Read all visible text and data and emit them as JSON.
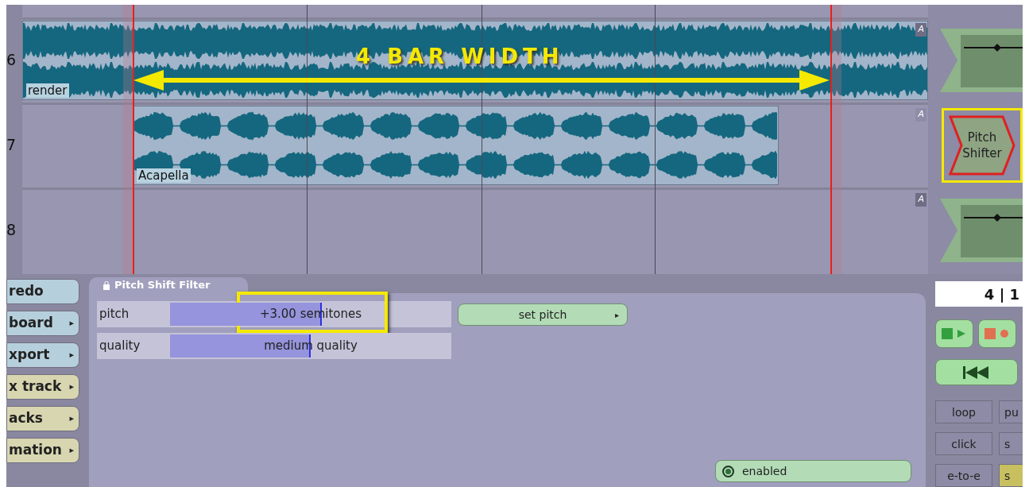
{
  "tracks": [
    {
      "number": "6",
      "badge": "A",
      "clip": {
        "name": "render",
        "kind": "full"
      },
      "plugin": {
        "kind": "automation"
      }
    },
    {
      "number": "7",
      "badge": "A",
      "clip": {
        "name": "Acapella",
        "kind": "vocal"
      },
      "plugin": {
        "kind": "effect",
        "label": "Pitch Shifter",
        "highlighted": true
      }
    },
    {
      "number": "8",
      "badge": "A",
      "plugin": {
        "kind": "automation"
      }
    }
  ],
  "annotation": {
    "text": "4 BAR WIDTH"
  },
  "menu": [
    {
      "label": "redo",
      "color": "#b6cfdc"
    },
    {
      "label": "board",
      "arrow": "▸",
      "color": "#b6cfdc"
    },
    {
      "label": "xport",
      "arrow": "▸",
      "color": "#b6cfdc"
    },
    {
      "label": "x track",
      "arrow": "▸",
      "color": "#d8d6b0"
    },
    {
      "label": "acks",
      "arrow": "▸",
      "color": "#d8d6b0"
    },
    {
      "label": "mation",
      "arrow": "▸",
      "color": "#d8d6b0"
    }
  ],
  "filter_panel": {
    "title": "Pitch Shift Filter",
    "params": [
      {
        "name": "pitch",
        "value": "+3.00 semitones",
        "level": 0.54,
        "highlighted": true
      },
      {
        "name": "quality",
        "value": "medium quality",
        "level": 0.5,
        "highlighted": false
      }
    ],
    "action": {
      "label": "set pitch",
      "arrow": "▸"
    },
    "enabled": {
      "label": "enabled",
      "on": true
    }
  },
  "transport": {
    "position": "4 | 1",
    "toggles": [
      {
        "label": "loop",
        "on": false
      },
      {
        "label": "pu",
        "on": false
      },
      {
        "label": "click",
        "on": false
      },
      {
        "label": "s",
        "on": false
      },
      {
        "label": "e-to-e",
        "on": false
      },
      {
        "label": "s",
        "on": true
      }
    ]
  }
}
